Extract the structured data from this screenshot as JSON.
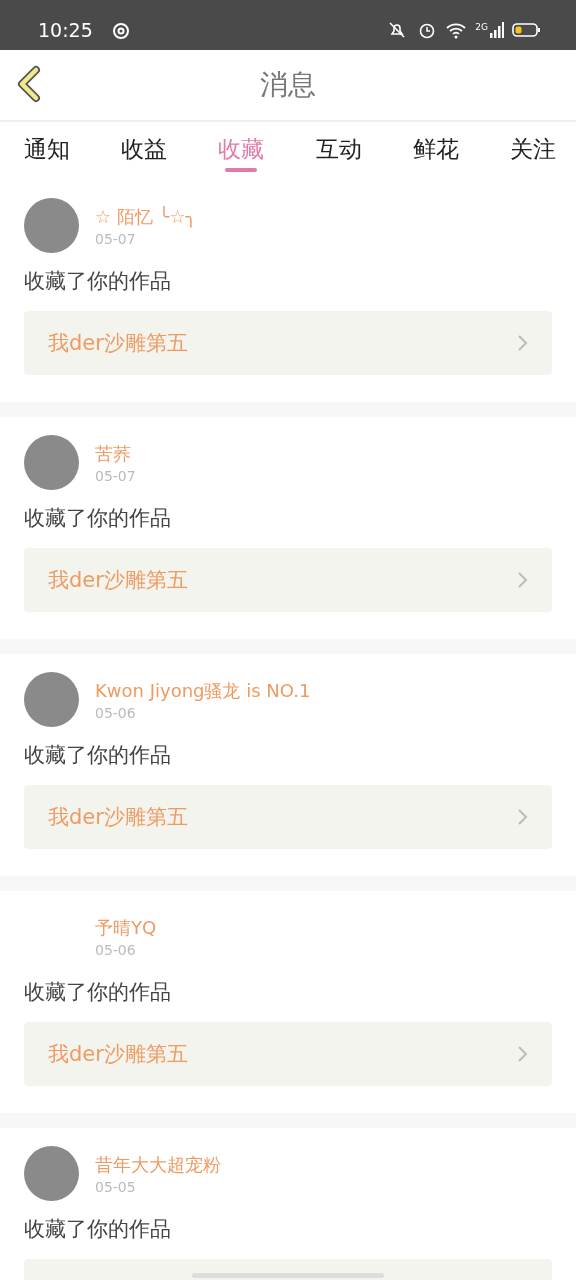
{
  "status_bar": {
    "time": "10:25",
    "network": "2G"
  },
  "header": {
    "title": "消息"
  },
  "tabs": [
    {
      "label": "通知",
      "selected": false
    },
    {
      "label": "收益",
      "selected": false
    },
    {
      "label": "收藏",
      "selected": true
    },
    {
      "label": "互动",
      "selected": false
    },
    {
      "label": "鲜花",
      "selected": false
    },
    {
      "label": "关注",
      "selected": false
    }
  ],
  "messages": [
    {
      "user": "☆ 陌忆 ╰☆╮",
      "date": "05-07",
      "avatar": true,
      "action": "收藏了你的作品",
      "work": "我der沙雕第五"
    },
    {
      "user": "苦荞",
      "date": "05-07",
      "avatar": true,
      "action": "收藏了你的作品",
      "work": "我der沙雕第五"
    },
    {
      "user": "Kwon Jiyong骚龙 is NO.1",
      "date": "05-06",
      "avatar": true,
      "action": "收藏了你的作品",
      "work": "我der沙雕第五"
    },
    {
      "user": "予晴YQ",
      "date": "05-06",
      "avatar": false,
      "action": "收藏了你的作品",
      "work": "我der沙雕第五"
    },
    {
      "user": "昔年大大超宠粉",
      "date": "05-05",
      "avatar": true,
      "action": "收藏了你的作品"
    }
  ]
}
